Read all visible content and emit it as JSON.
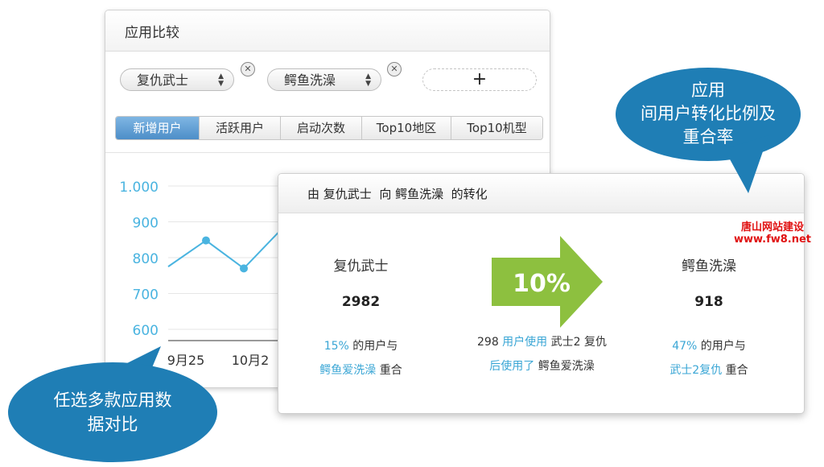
{
  "compare_panel": {
    "title": "应用比较",
    "app_selectors": [
      {
        "label": "复仇武士"
      },
      {
        "label": "鳄鱼洗澡"
      }
    ],
    "remove_icon": "close-icon",
    "add_label": "+",
    "tabs": [
      {
        "label": "新增用户",
        "active": true
      },
      {
        "label": "活跃用户",
        "active": false
      },
      {
        "label": "启动次数",
        "active": false
      },
      {
        "label": "Top10地区",
        "active": false
      },
      {
        "label": "Top10机型",
        "active": false
      }
    ]
  },
  "chart_data": {
    "type": "line",
    "y_ticks": [
      "1.000",
      "900",
      "800",
      "700",
      "600"
    ],
    "ylim": [
      600,
      1000
    ],
    "x_ticks": [
      "9月25",
      "10月2"
    ],
    "series": [
      {
        "x": [
          0,
          1,
          2,
          3
        ],
        "values": [
          775,
          848,
          770,
          880
        ]
      }
    ],
    "line_color": "#4ab4e0",
    "grid": true
  },
  "conversion_panel": {
    "title_parts": [
      "由 ",
      "复仇武士",
      "  向 ",
      "鳄鱼洗澡",
      "  的转化"
    ],
    "from_app": {
      "name": "复仇武士",
      "count": "2982",
      "pct": "15%",
      "desc_1": " 的用户与",
      "desc_2a": "鳄鱼爱洗澡",
      "desc_2b": " 重合"
    },
    "conversion_rate": "10%",
    "middle": {
      "line1a": "298 ",
      "line1b": "用户使用",
      "line1c": " 武士2 复仇",
      "line2a": "后使用了",
      "line2b": " 鳄鱼爱洗澡"
    },
    "to_app": {
      "name": "鳄鱼洗澡",
      "count": "918",
      "pct": "47%",
      "desc_1": " 的用户与",
      "desc_2a": "武士2复仇",
      "desc_2b": " 重合"
    },
    "arrow_color": "#8dc03f"
  },
  "callouts": {
    "top_right": [
      "应用",
      "间用户转化比例及",
      "重合率"
    ],
    "bottom_left": [
      "任选多款应用数",
      "据对比"
    ],
    "color": "#1f7eb5"
  },
  "watermark": {
    "line1": "唐山网站建设",
    "line2": "www.fw8.net"
  }
}
